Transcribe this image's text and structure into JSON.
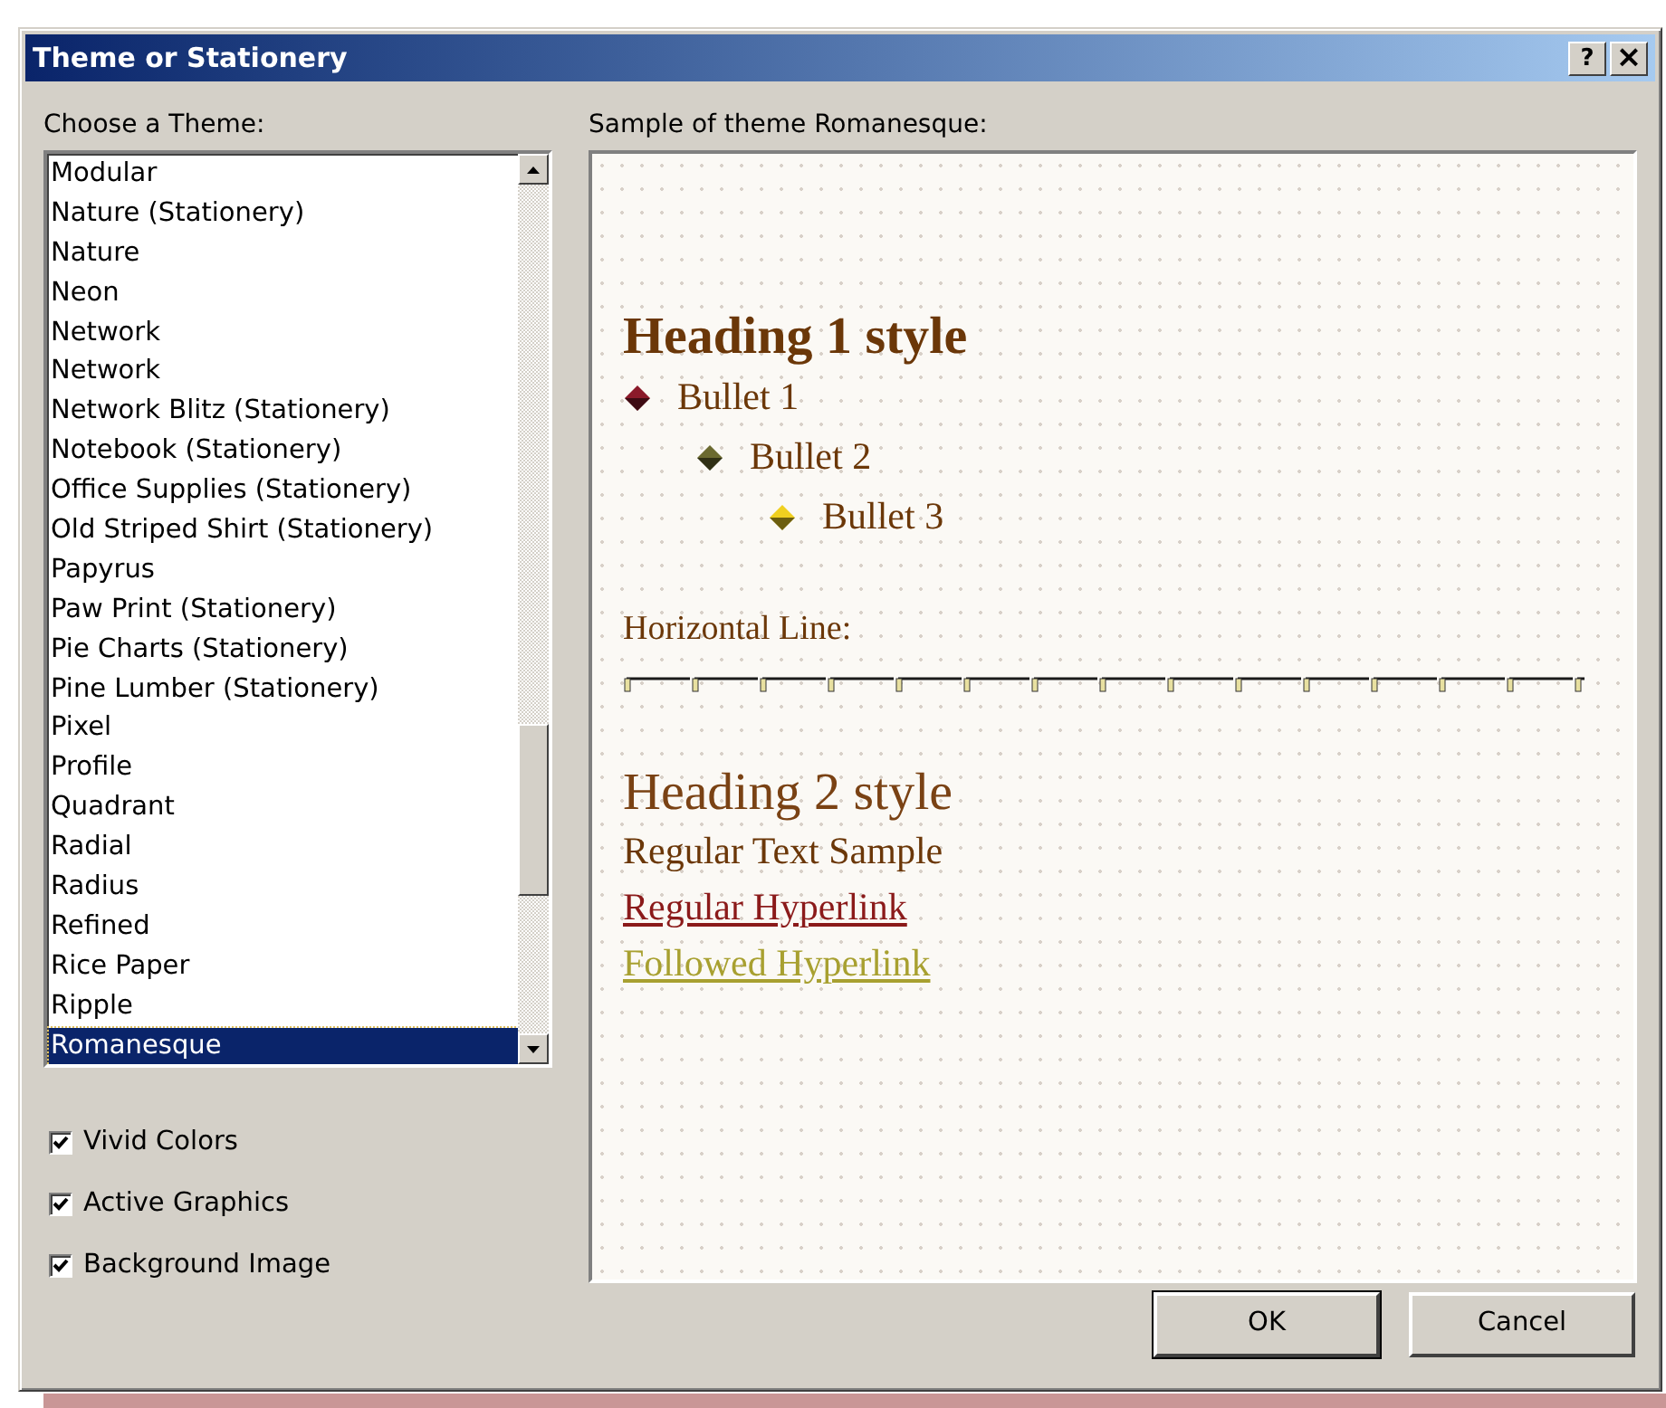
{
  "window": {
    "title": "Theme or Stationery",
    "help_button": "?",
    "close_button": "×"
  },
  "theme_list": {
    "label": "Choose a Theme:",
    "items": [
      {
        "name": "Modular",
        "selected": false
      },
      {
        "name": "Nature (Stationery)",
        "selected": false
      },
      {
        "name": "Nature",
        "selected": false
      },
      {
        "name": "Neon",
        "selected": false
      },
      {
        "name": "Network",
        "selected": false
      },
      {
        "name": "Network",
        "selected": false
      },
      {
        "name": "Network Blitz (Stationery)",
        "selected": false
      },
      {
        "name": "Notebook (Stationery)",
        "selected": false
      },
      {
        "name": "Office Supplies (Stationery)",
        "selected": false
      },
      {
        "name": "Old Striped Shirt (Stationery)",
        "selected": false
      },
      {
        "name": "Papyrus",
        "selected": false
      },
      {
        "name": "Paw Print (Stationery)",
        "selected": false
      },
      {
        "name": "Pie Charts (Stationery)",
        "selected": false
      },
      {
        "name": "Pine Lumber (Stationery)",
        "selected": false
      },
      {
        "name": "Pixel",
        "selected": false
      },
      {
        "name": "Profile",
        "selected": false
      },
      {
        "name": "Quadrant",
        "selected": false
      },
      {
        "name": "Radial",
        "selected": false
      },
      {
        "name": "Radius",
        "selected": false
      },
      {
        "name": "Refined",
        "selected": false
      },
      {
        "name": "Rice Paper",
        "selected": false
      },
      {
        "name": "Ripple",
        "selected": false
      },
      {
        "name": "Romanesque",
        "selected": true
      }
    ]
  },
  "options": [
    {
      "label": "Vivid Colors",
      "checked": true
    },
    {
      "label": "Active Graphics",
      "checked": true
    },
    {
      "label": "Background Image",
      "checked": true
    }
  ],
  "sample": {
    "label": "Sample of theme Romanesque:",
    "heading1": "Heading 1 style",
    "bullets": [
      {
        "text": "Bullet 1",
        "color": "#8b1a2a"
      },
      {
        "text": "Bullet 2",
        "color": "#6b6a30"
      },
      {
        "text": "Bullet 3",
        "color": "#f0d020"
      }
    ],
    "line_label": "Horizontal Line:",
    "heading2": "Heading 2 style",
    "regular_text": "Regular Text Sample",
    "hyperlink": "Regular Hyperlink",
    "followed_hyperlink": "Followed Hyperlink"
  },
  "buttons": [
    {
      "label": "OK",
      "default": true
    },
    {
      "label": "Cancel",
      "default": false
    }
  ]
}
